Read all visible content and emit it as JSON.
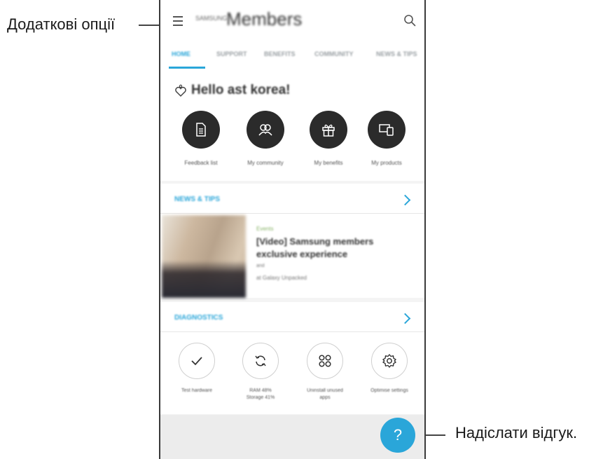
{
  "callouts": {
    "more_options": "Додаткові опції",
    "send_feedback": "Надіслати відгук."
  },
  "appbar": {
    "brand": "SAMSUNG",
    "title": "Members",
    "menu_icon": "menu-icon",
    "search_icon": "search-icon"
  },
  "tabs": [
    {
      "label": "HOME",
      "active": true
    },
    {
      "label": "SUPPORT",
      "active": false
    },
    {
      "label": "BENEFITS",
      "active": false
    },
    {
      "label": "COMMUNITY",
      "active": false
    },
    {
      "label": "NEWS & TIPS",
      "active": false
    }
  ],
  "greeting": {
    "text": "Hello ast korea!",
    "icon": "heart-hand-icon"
  },
  "quick_actions": [
    {
      "label": "Feedback list",
      "icon": "document-icon"
    },
    {
      "label": "My community",
      "icon": "people-icon"
    },
    {
      "label": "My benefits",
      "icon": "gift-icon"
    },
    {
      "label": "My products",
      "icon": "devices-icon"
    }
  ],
  "news": {
    "header": "NEWS & TIPS",
    "tag": "Events",
    "title": "[Video] Samsung members exclusive experience",
    "subtitle": "and",
    "source": "at Galaxy Unpacked"
  },
  "diagnostics": {
    "header": "DIAGNOSTICS",
    "items": [
      {
        "label": "Test hardware",
        "icon": "check-icon"
      },
      {
        "label": "RAM 48%\nStorage 41%",
        "icon": "refresh-icon"
      },
      {
        "label": "Uninstall unused\napps",
        "icon": "apps-grid-icon"
      },
      {
        "label": "Optimise settings",
        "icon": "settings-gear-icon"
      }
    ]
  },
  "fab": {
    "label": "?",
    "icon": "help-icon"
  },
  "colors": {
    "accent": "#2aa6d9",
    "quick_circle": "#2b2b2b",
    "background": "#f4f4f4"
  }
}
